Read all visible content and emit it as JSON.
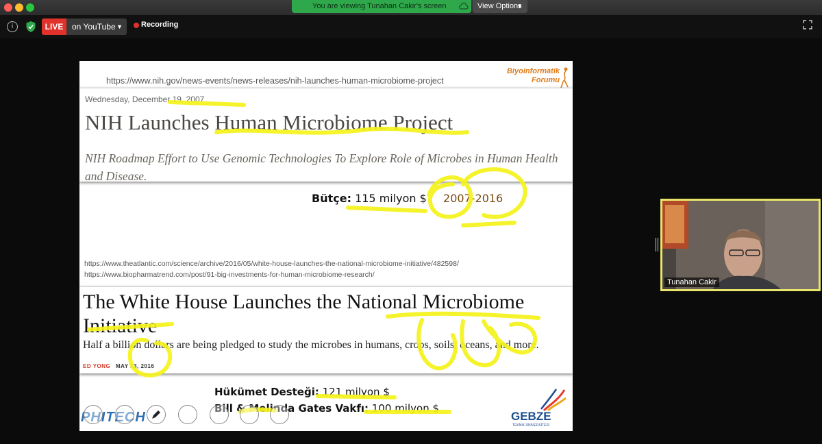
{
  "window": {
    "share_banner": "You are viewing Tunahan Cakir's screen",
    "view_options": "View Options"
  },
  "toolbar": {
    "live_badge": "LIVE",
    "live_target": "on YouTube",
    "recording": "Recording"
  },
  "slide": {
    "logo_top_line1": "Biyoinformatik",
    "logo_top_line2": "Forumu",
    "url_nih": "https://www.nih.gov/news-events/news-releases/nih-launches-human-microbiome-project",
    "nih_card": {
      "date": "Wednesday, December 19, 2007",
      "title": "NIH Launches Human Microbiome Project",
      "subtitle": "NIH Roadmap Effort to Use Genomic Technologies To Explore Role of Microbes in Human Health and Disease."
    },
    "budget": {
      "label": "Bütçe:",
      "amount": "115 milyon $",
      "years": "2007-2016"
    },
    "url_atlantic": "https://www.theatlantic.com/science/archive/2016/05/white-house-launches-the-national-microbiome-initiative/482598/",
    "url_biopharma": "https://www.biopharmatrend.com/post/91-big-investments-for-human-microbiome-research/",
    "wh_card": {
      "title": "The White House Launches the National Microbiome Initiative",
      "subtitle": "Half a billion dollars are being pledged to study the microbes in humans, crops, soils, oceans, and more.",
      "author": "ED YONG",
      "date": "MAY 13, 2016"
    },
    "funding": {
      "gov_label": "Hükümet Desteği:",
      "gov_amount": "121 milyon $",
      "gates_label": "Bill & Melinda Gates Vakfı:",
      "gates_amount": "100 milyon $"
    },
    "logo_bottom_left": "PHITECH",
    "logo_bottom_right": "GEBZE",
    "logo_bottom_right_sub": "TEKNİK ÜNİVERSİTESİ"
  },
  "participant": {
    "name": "Tunahan Cakir"
  },
  "colors": {
    "live_red": "#e0322b",
    "banner_green": "#2ea84a",
    "highlight_yellow": "#f5f31b",
    "video_border": "#e7e56a"
  }
}
